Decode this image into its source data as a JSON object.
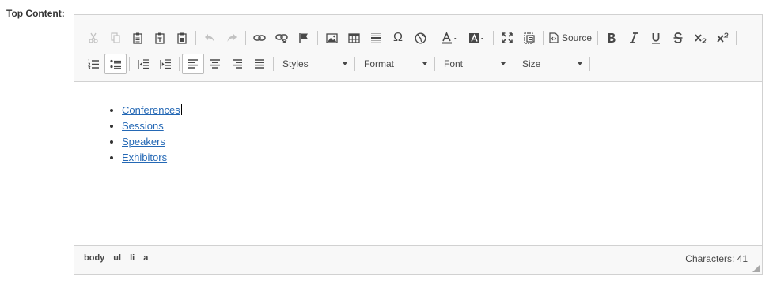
{
  "field": {
    "label": "Top Content:"
  },
  "toolbar": {
    "source_label": "Source",
    "styles_label": "Styles",
    "format_label": "Format",
    "font_label": "Font",
    "size_label": "Size",
    "omega_glyph": "Ω"
  },
  "content": {
    "list_items": [
      "Conferences",
      "Sessions",
      "Speakers",
      "Exhibitors"
    ]
  },
  "status": {
    "path": [
      "body",
      "ul",
      "li",
      "a"
    ],
    "char_count": "Characters: 41"
  },
  "colors": {
    "link": "#2468b5",
    "toolbar_bg": "#f8f8f8",
    "border": "#d1d1d1"
  }
}
